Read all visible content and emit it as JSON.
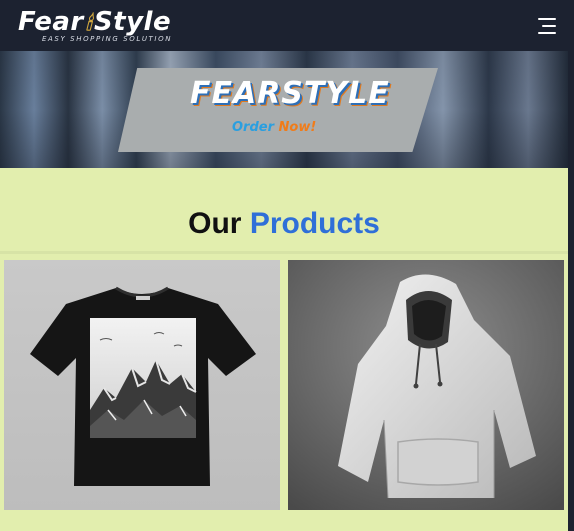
{
  "navbar": {
    "logo_word_left": "Fear",
    "logo_word_right": "Style",
    "tagline": "EASY SHOPPING SOLUTION",
    "menu_icon": "hamburger-menu-icon"
  },
  "hero": {
    "title": "FEARSTYLE",
    "cta_part1": "Order",
    "cta_part2": "Now!"
  },
  "products_section": {
    "heading_plain": "Our",
    "heading_accent": "Products"
  },
  "products": [
    {
      "name": "mountain-print-tshirt",
      "image": "black-tshirt-mountain-graphic"
    },
    {
      "name": "white-hoodie",
      "image": "white-hoodie-photo"
    }
  ],
  "colors": {
    "page_background": "#e2eeae",
    "navbar": "#1c2230",
    "accent": "#2f6fd8",
    "cta_blue": "#2a9fe0",
    "cta_orange": "#f07c1a"
  }
}
